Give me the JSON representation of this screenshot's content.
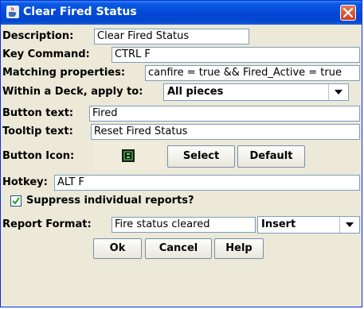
{
  "window": {
    "title": "Clear Fired Status",
    "close_icon": "close-icon",
    "app_icon": "java-coffee-icon"
  },
  "form": {
    "description_label": "Description:",
    "description_value": "Clear Fired Status",
    "key_command_label": "Key Command:",
    "key_command_value": "CTRL F",
    "matching_label": "Matching properties:",
    "matching_value": "canfire = true && Fired_Active = true",
    "deck_label": "Within a Deck, apply to:",
    "deck_value": "All pieces",
    "button_text_label": "Button text:",
    "button_text_value": "Fired",
    "tooltip_label": "Tooltip text:",
    "tooltip_value": "Reset Fired Status",
    "button_icon_label": "Button Icon:",
    "select_label": "Select",
    "default_label": "Default",
    "hotkey_label": "Hotkey:",
    "hotkey_value": "ALT F",
    "suppress_label": "Suppress individual reports?",
    "suppress_checked": true,
    "report_format_label": "Report Format:",
    "report_format_value": "Fire status cleared",
    "insert_value": "Insert"
  },
  "buttons": {
    "ok": "Ok",
    "cancel": "Cancel",
    "help": "Help"
  },
  "colors": {
    "titlebar": "#0347d5",
    "dialog_bg": "#ece9d8",
    "icon_bg": "#f1ecdd"
  }
}
